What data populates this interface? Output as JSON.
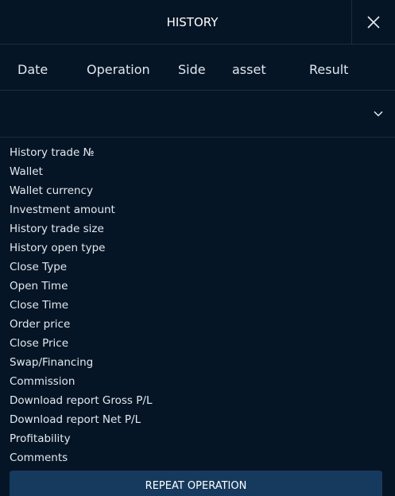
{
  "header": {
    "title": "HISTORY",
    "close_icon": "close-icon"
  },
  "table": {
    "columns": [
      "Date",
      "Operation",
      "Side",
      "asset",
      "Result"
    ]
  },
  "row": {
    "expand_icon": "chevron-down-icon"
  },
  "details": {
    "fields": [
      "History trade №",
      "Wallet",
      "Wallet currency",
      "Investment amount",
      "History trade size",
      "History open type",
      "Close Type",
      "Open Time",
      "Close Time",
      "Order price",
      "Close Price",
      "Swap/Financing",
      "Commission",
      "Download report Gross P/L",
      "Download report Net P/L",
      "Profitability",
      "Comments"
    ]
  },
  "actions": {
    "repeat_label": "REPEAT OPERATION"
  },
  "colors": {
    "background": "#061526",
    "divider": "#1d2c3d",
    "button": "#163a5d",
    "text": "#dfe6ee"
  }
}
